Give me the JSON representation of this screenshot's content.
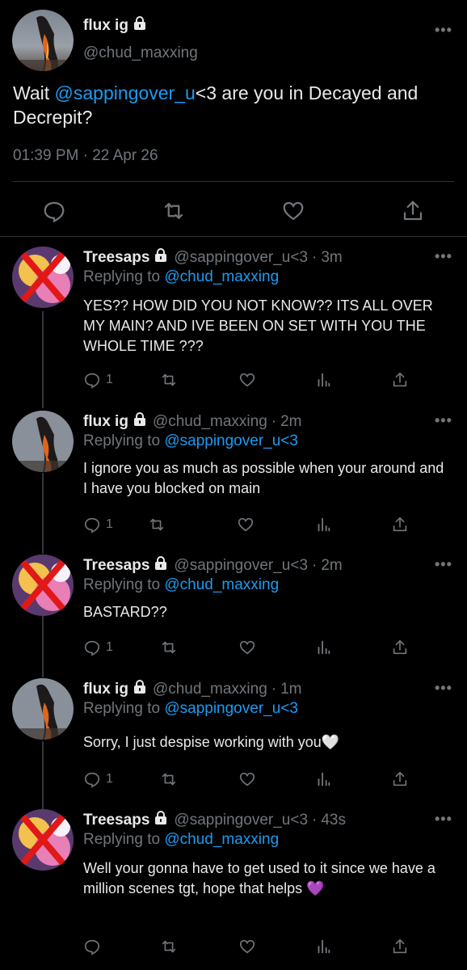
{
  "main": {
    "name": "flux ig",
    "handle": "@chud_maxxing",
    "text_before": "Wait ",
    "mention": "@sappingover_u",
    "text_after": "<3 are you in Decayed and Decrepit?",
    "timestamp": "01:39 PM · 22 Apr 26",
    "icons": [
      "reply-icon",
      "retweet-icon",
      "like-icon",
      "share-icon"
    ]
  },
  "replies": [
    {
      "name": "Treesaps",
      "handle": "@sappingover_u<3",
      "time": "3m",
      "replying_prefix": "Replying to",
      "replying_to": "@chud_maxxing",
      "text": "YES?? HOW DID YOU NOT KNOW?? ITS ALL OVER MY MAIN? AND IVE BEEN ON SET WITH YOU THE WHOLE TIME ???",
      "reply_count": "1"
    },
    {
      "name": "flux ig",
      "handle": "@chud_maxxing",
      "time": "2m",
      "replying_prefix": "Replying to",
      "replying_to": "@sappingover_u<3",
      "text": "I ignore you as much as possible when your around and I have you blocked on main",
      "reply_count": "1"
    },
    {
      "name": "Treesaps",
      "handle": "@sappingover_u<3",
      "time": "2m",
      "replying_prefix": "Replying to",
      "replying_to": "@chud_maxxing",
      "text": "BASTARD??",
      "reply_count": "1"
    },
    {
      "name": "flux ig",
      "handle": "@chud_maxxing",
      "time": "1m",
      "replying_prefix": "Replying to",
      "replying_to": "@sappingover_u<3",
      "text": "Sorry, I just despise working with you🤍",
      "reply_count": "1"
    },
    {
      "name": "Treesaps",
      "handle": "@sappingover_u<3",
      "time": "43s",
      "replying_prefix": "Replying to",
      "replying_to": "@chud_maxxing",
      "text": "Well your gonna have to get used to it since we have a million scenes tgt, hope that helps 💜",
      "reply_count": ""
    }
  ],
  "colors": {
    "background": "#000000",
    "text": "#e7e9ea",
    "secondary": "#71767b",
    "link": "#1d9bf0",
    "divider": "#2f3336"
  }
}
